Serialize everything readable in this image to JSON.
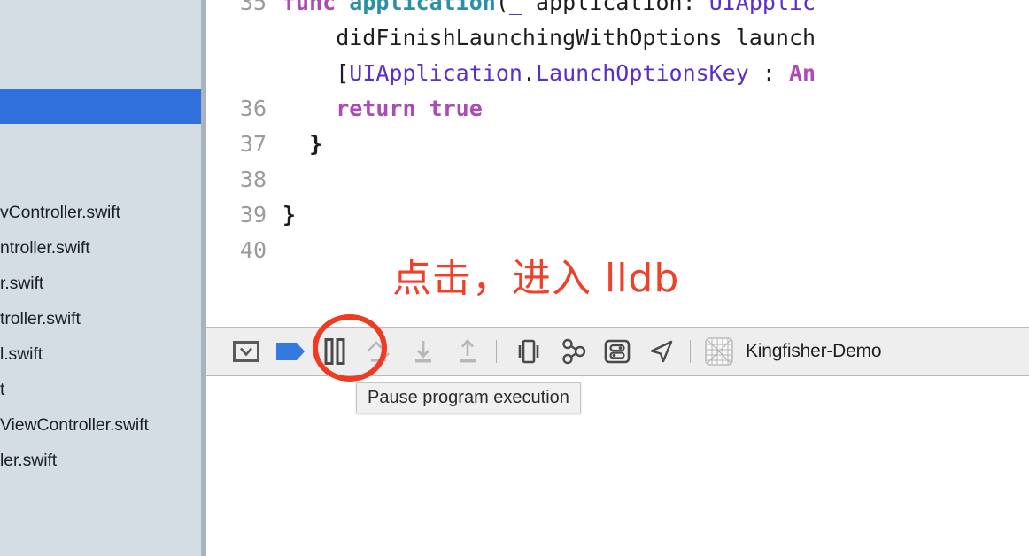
{
  "window": {
    "accent_blue": "#2f70dd",
    "annotation_red": "#ee3b22",
    "sidebar_bg": "#d4dce4"
  },
  "sidebar": {
    "name": "project-navigator",
    "rows": [
      {
        "label": "",
        "selected": false
      },
      {
        "label": "",
        "selected": false
      },
      {
        "label": "",
        "selected": false
      },
      {
        "label": "",
        "selected": true
      },
      {
        "label": "",
        "selected": false
      },
      {
        "label": "",
        "selected": false
      },
      {
        "label": "vController.swift",
        "selected": false
      },
      {
        "label": "ntroller.swift",
        "selected": false
      },
      {
        "label": "r.swift",
        "selected": false
      },
      {
        "label": "troller.swift",
        "selected": false
      },
      {
        "label": "l.swift",
        "selected": false
      },
      {
        "label": "t",
        "selected": false
      },
      {
        "label": "ViewController.swift",
        "selected": false
      },
      {
        "label": "ler.swift",
        "selected": false
      }
    ]
  },
  "editor": {
    "name": "source-editor",
    "language": "swift",
    "lines": [
      {
        "number": "35",
        "tokens": [
          {
            "text": "func ",
            "type": "keyword"
          },
          {
            "text": "application",
            "type": "func"
          },
          {
            "text": "(",
            "type": "punct"
          },
          {
            "text": "_",
            "type": "param"
          },
          {
            "text": " application: ",
            "type": "plain"
          },
          {
            "text": "UIApplic",
            "type": "type"
          }
        ]
      },
      {
        "number": "",
        "tokens": [
          {
            "text": "    didFinishLaunchingWithOptions launch",
            "type": "plain"
          }
        ]
      },
      {
        "number": "",
        "tokens": [
          {
            "text": "    [",
            "type": "plain"
          },
          {
            "text": "UIApplication",
            "type": "type"
          },
          {
            "text": ".",
            "type": "punct"
          },
          {
            "text": "LaunchOptionsKey",
            "type": "type"
          },
          {
            "text": " : ",
            "type": "plain"
          },
          {
            "text": "An",
            "type": "keyword"
          }
        ]
      },
      {
        "number": "36",
        "tokens": [
          {
            "text": "    return true",
            "type": "keyword"
          }
        ]
      },
      {
        "number": "37",
        "tokens": [
          {
            "text": "  }",
            "type": "brace"
          }
        ]
      },
      {
        "number": "38",
        "tokens": []
      },
      {
        "number": "39",
        "tokens": [
          {
            "text": "}",
            "type": "brace"
          }
        ]
      },
      {
        "number": "40",
        "tokens": []
      }
    ]
  },
  "annotation": {
    "name": "chinese-annotation",
    "text": "点击，进入 lldb",
    "color": "#ef412a"
  },
  "debug_bar": {
    "name": "debug-toolbar",
    "buttons": [
      {
        "name": "toggle-debug-area-button",
        "icon": "hide-debug-area-icon",
        "label": "Hide or show the Debug area",
        "enabled": true
      },
      {
        "name": "deactivate-breakpoints-button",
        "icon": "breakpoint-flag-icon",
        "label": "Deactivate breakpoints",
        "enabled": true
      },
      {
        "name": "pause-button",
        "icon": "pause-icon",
        "label": "Pause program execution",
        "enabled": true
      },
      {
        "name": "step-over-button",
        "icon": "step-over-icon",
        "label": "Step over",
        "enabled": false
      },
      {
        "name": "step-into-button",
        "icon": "step-into-icon",
        "label": "Step into",
        "enabled": false
      },
      {
        "name": "step-out-button",
        "icon": "step-out-icon",
        "label": "Step out",
        "enabled": false
      },
      {
        "name": "debug-view-hierarchy-button",
        "icon": "view-hierarchy-icon",
        "label": "Debug View Hierarchy",
        "enabled": true
      },
      {
        "name": "debug-memory-graph-button",
        "icon": "memory-graph-icon",
        "label": "Debug Memory Graph",
        "enabled": true
      },
      {
        "name": "environment-overrides-button",
        "icon": "environment-overrides-icon",
        "label": "Environment Overrides",
        "enabled": true
      },
      {
        "name": "simulate-location-button",
        "icon": "location-arrow-icon",
        "label": "Simulate Location",
        "enabled": true
      }
    ],
    "scheme": {
      "icon": "process-grid-icon",
      "label": "Kingfisher-Demo"
    }
  },
  "tooltip": {
    "name": "pause-tooltip",
    "text": "Pause program execution"
  },
  "console": {
    "name": "debug-console",
    "text": ""
  }
}
